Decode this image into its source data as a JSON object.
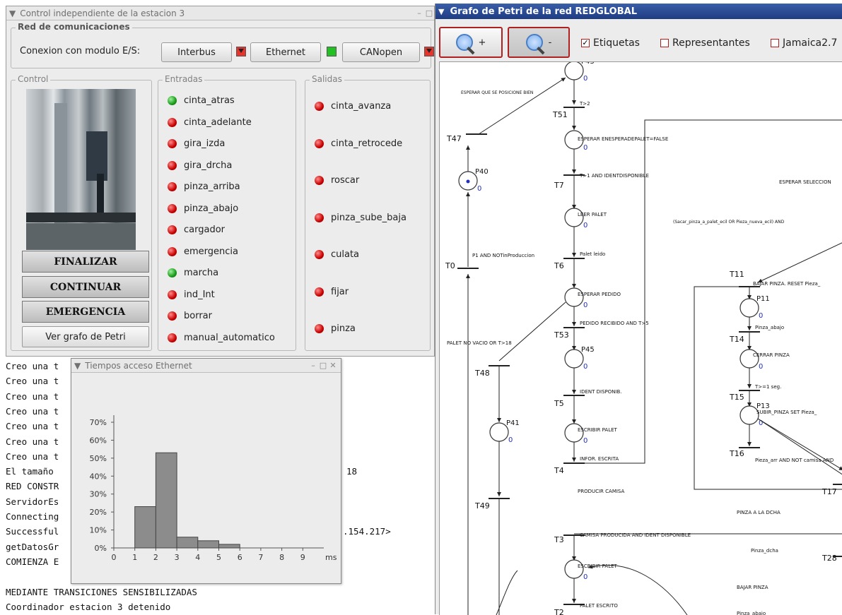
{
  "control_window": {
    "title": "Control independiente de la estacion 3",
    "red": {
      "legend": "Red de comunicaciones",
      "label": "Conexion con modulo E/S:",
      "modules": [
        {
          "label": "Interbus",
          "status_color": "#e8342a"
        },
        {
          "label": "Ethernet",
          "status_color": "#22c022"
        },
        {
          "label": "CANopen",
          "status_color": "#e8342a"
        }
      ]
    },
    "control": {
      "legend": "Control",
      "buttons": [
        "FINALIZAR",
        "CONTINUAR",
        "EMERGENCIA"
      ],
      "ver_grafo": "Ver grafo de Petri"
    },
    "entradas": {
      "legend": "Entradas",
      "items": [
        {
          "label": "cinta_atras",
          "state": "green"
        },
        {
          "label": "cinta_adelante",
          "state": "red"
        },
        {
          "label": "gira_izda",
          "state": "red"
        },
        {
          "label": "gira_drcha",
          "state": "red"
        },
        {
          "label": "pinza_arriba",
          "state": "red"
        },
        {
          "label": "pinza_abajo",
          "state": "red"
        },
        {
          "label": "cargador",
          "state": "red"
        },
        {
          "label": "emergencia",
          "state": "red"
        },
        {
          "label": "marcha",
          "state": "green"
        },
        {
          "label": "ind_Int",
          "state": "red"
        },
        {
          "label": "borrar",
          "state": "red"
        },
        {
          "label": "manual_automatico",
          "state": "red"
        }
      ]
    },
    "salidas": {
      "legend": "Salidas",
      "items": [
        {
          "label": "cinta_avanza",
          "state": "red"
        },
        {
          "label": "cinta_retrocede",
          "state": "red"
        },
        {
          "label": "roscar",
          "state": "red"
        },
        {
          "label": "pinza_sube_baja",
          "state": "red"
        },
        {
          "label": "culata",
          "state": "red"
        },
        {
          "label": "fijar",
          "state": "red"
        },
        {
          "label": "pinza",
          "state": "red"
        }
      ]
    }
  },
  "console": {
    "lines": [
      "Creo una t",
      "Creo una t",
      "Creo una t",
      "Creo una t",
      "Creo una t",
      "Creo una t",
      "Creo una t",
      "El tamaño",
      "RED CONSTR",
      "ServidorEs",
      "Connecting",
      "Successful",
      "getDatosGr",
      "COMIENZA E",
      "",
      "MEDIANTE TRANSICIONES SENSIBILIZADAS",
      "Coordinador estacion 3 detenido"
    ],
    "tail_18": "18",
    "tail_ip": ".154.217>"
  },
  "histogram_window": {
    "title": "Tiempos acceso Ethernet",
    "chart_data": {
      "type": "bar",
      "x_ticks": [
        "0",
        "1",
        "2",
        "3",
        "4",
        "5",
        "6",
        "7",
        "8",
        "9"
      ],
      "x_unit": "ms",
      "bins": [
        [
          1,
          2
        ],
        [
          2,
          3
        ],
        [
          3,
          4
        ],
        [
          4,
          5
        ],
        [
          5,
          6
        ]
      ],
      "values": [
        23,
        53,
        6,
        4,
        2
      ],
      "y_ticks": [
        "0%",
        "10%",
        "20%",
        "30%",
        "40%",
        "50%",
        "60%",
        "70%"
      ],
      "ylim": [
        0,
        70
      ],
      "xlim": [
        0,
        10
      ]
    }
  },
  "petri_window": {
    "title": "Grafo de Petri de la red REDGLOBAL",
    "toolbar": {
      "zoom_in": "+",
      "zoom_out": "-",
      "etiquetas": "Etiquetas",
      "etiquetas_checked": true,
      "representantes": "Representantes",
      "jamaica": "Jamaica2.7"
    },
    "places": [
      "P43",
      "P40",
      "P41",
      "P45",
      "P11",
      "P13"
    ],
    "place_tokens": "0",
    "transitions": [
      "T51",
      "T47",
      "T7",
      "T6",
      "T0",
      "T53",
      "T48",
      "T5",
      "T4",
      "T49",
      "T3",
      "T2",
      "T11",
      "T14",
      "T15",
      "T16",
      "T17",
      "T28"
    ],
    "labels": [
      "ESPERAR QUE SE POSICIONE BIEN",
      "T>2",
      "ESPERAR ENESPERADEPALET=FALSE",
      "T>1 AND IDENTDISPONIBLE",
      "LEER PALET",
      "P1 AND NOTinProduccion",
      "Palet leido",
      "ESPERAR PEDIDO",
      "PEDIDO RECIBIDO AND T>5",
      "PALET NO VACIO OR T>18",
      "IDENT DISPONIB.",
      "ESCRIBIR PALET",
      "INFOR. ESCRITA",
      "PRODUCIR CAMISA",
      "CAMISA PRODUCIDA AND IDENT DISPONIBLE",
      "ESCRIBIR PALET",
      "PALET ESCRITO",
      "ESPERAR SELECCION",
      "(Sacar_pinza_a_palet_ecil OR Pieza_nueva_ecil) AND",
      "BAJAR PINZA. RESET Pieza_",
      "Pinza_abajo",
      "CERRAR PINZA",
      "T>=1 seg.",
      "SUBIR_PINZA SET Pieza_",
      "Pieza_arr AND NOT camisa AND",
      "PINZA A LA DCHA",
      "Pinza_dcha",
      "BAJAR PINZA",
      "Pinza_abajo"
    ]
  }
}
